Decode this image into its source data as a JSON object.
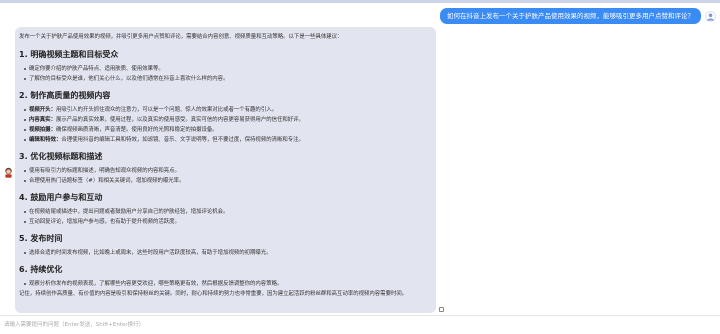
{
  "user_message": {
    "text": "如何在抖音上发布一个关于护肤产品使用效果的视频，能够吸引更多用户点赞和评论？"
  },
  "assistant_message": {
    "intro": "发布一个关于护肤产品使用效果的视频，并吸引更多用户点赞和评论，需要结合内容创意、视频质量和互动策略。以下是一些具体建议：",
    "sections": [
      {
        "title": "1. 明确视频主题和目标受众",
        "items": [
          {
            "strong": "",
            "text": "确定你要介绍的护肤产品特点、适用肤质、使用效果等。"
          },
          {
            "strong": "",
            "text": "了解你的目标受众是谁，他们关心什么，以及他们通常在抖音上喜欢什么样的内容。"
          }
        ]
      },
      {
        "title": "2. 制作高质量的视频内容",
        "items": [
          {
            "strong": "视频开头：",
            "text": "用吸引人的开头抓住观众的注意力，可以是一个问题、惊人的效果对比或者一个有趣的引入。"
          },
          {
            "strong": "内容真实：",
            "text": "展示产品的真实效果，使用过程，以及真实的使用感受。真实可信的内容更容易获得用户的信任和好评。"
          },
          {
            "strong": "视频拍摄：",
            "text": "确保视频画质清晰，声音清楚。使用良好的光照和稳定的拍摄设备。"
          },
          {
            "strong": "编辑和特效：",
            "text": "合理使用抖音的编辑工具和特效，如滤镜、音乐、文字说明等，但不要过度，保持视频的清晰和专注。"
          }
        ]
      },
      {
        "title": "3. 优化视频标题和描述",
        "items": [
          {
            "strong": "",
            "text": "使用有吸引力的标题和描述，明确告知观众视频的内容和亮点。"
          },
          {
            "strong": "",
            "text": "合理使用热门话题标签（#）和相关关键词，增加视频的曝光率。"
          }
        ]
      },
      {
        "title": "4. 鼓励用户参与和互动",
        "items": [
          {
            "strong": "",
            "text": "在视频结尾或描述中，提出问题或者鼓励用户分享自己的护肤经验，增加评论机会。"
          },
          {
            "strong": "",
            "text": "互动回复评论，增加用户参与感，也有助于提升视频的活跃度。"
          }
        ]
      },
      {
        "title": "5. 发布时间",
        "items": [
          {
            "strong": "",
            "text": "选择合适的时间发布视频，比如晚上或周末，这些时段用户活跃度较高，有助于增加视频的初期曝光。"
          }
        ]
      },
      {
        "title": "6. 持续优化",
        "items": [
          {
            "strong": "",
            "text": "观察分析你发布的视频表现，了解哪些内容更受欢迎，哪些策略更有效，然后根据反馈调整你的内容策略。"
          }
        ]
      }
    ],
    "closing": "记住，持续创作高质量、有价值的内容是吸引和保持粉丝的关键。同时，耐心和持续的努力也非常重要，因为建立起活跃的粉丝群和高互动率的视频内容需要时间。"
  },
  "input": {
    "placeholder": "请输入需要提问的问题（Enter发送，Shift+Enter换行）"
  }
}
